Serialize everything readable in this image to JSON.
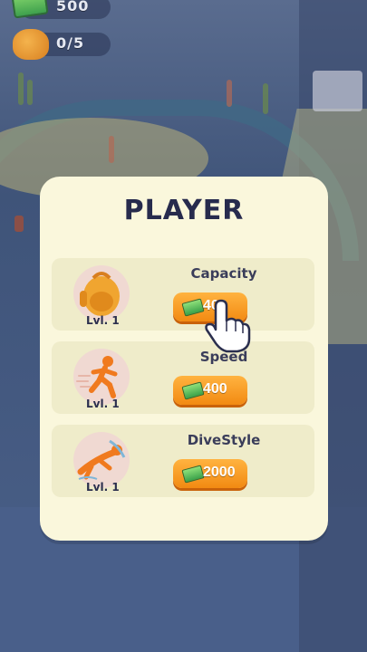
{
  "hud": {
    "cash": "500",
    "capacity": "0/5"
  },
  "panel": {
    "title": "PLAYER",
    "rows": [
      {
        "label": "Capacity",
        "level": "Lvl. 1",
        "price": "400",
        "icon": "backpack-icon"
      },
      {
        "label": "Speed",
        "level": "Lvl. 1",
        "price": "400",
        "icon": "running-man-icon"
      },
      {
        "label": "DiveStyle",
        "level": "Lvl. 1",
        "price": "2000",
        "icon": "diver-icon"
      }
    ]
  },
  "colors": {
    "panel_bg": "#faf7dc",
    "row_bg": "#efecca",
    "button": "#f28a12",
    "title": "#272b4d"
  }
}
